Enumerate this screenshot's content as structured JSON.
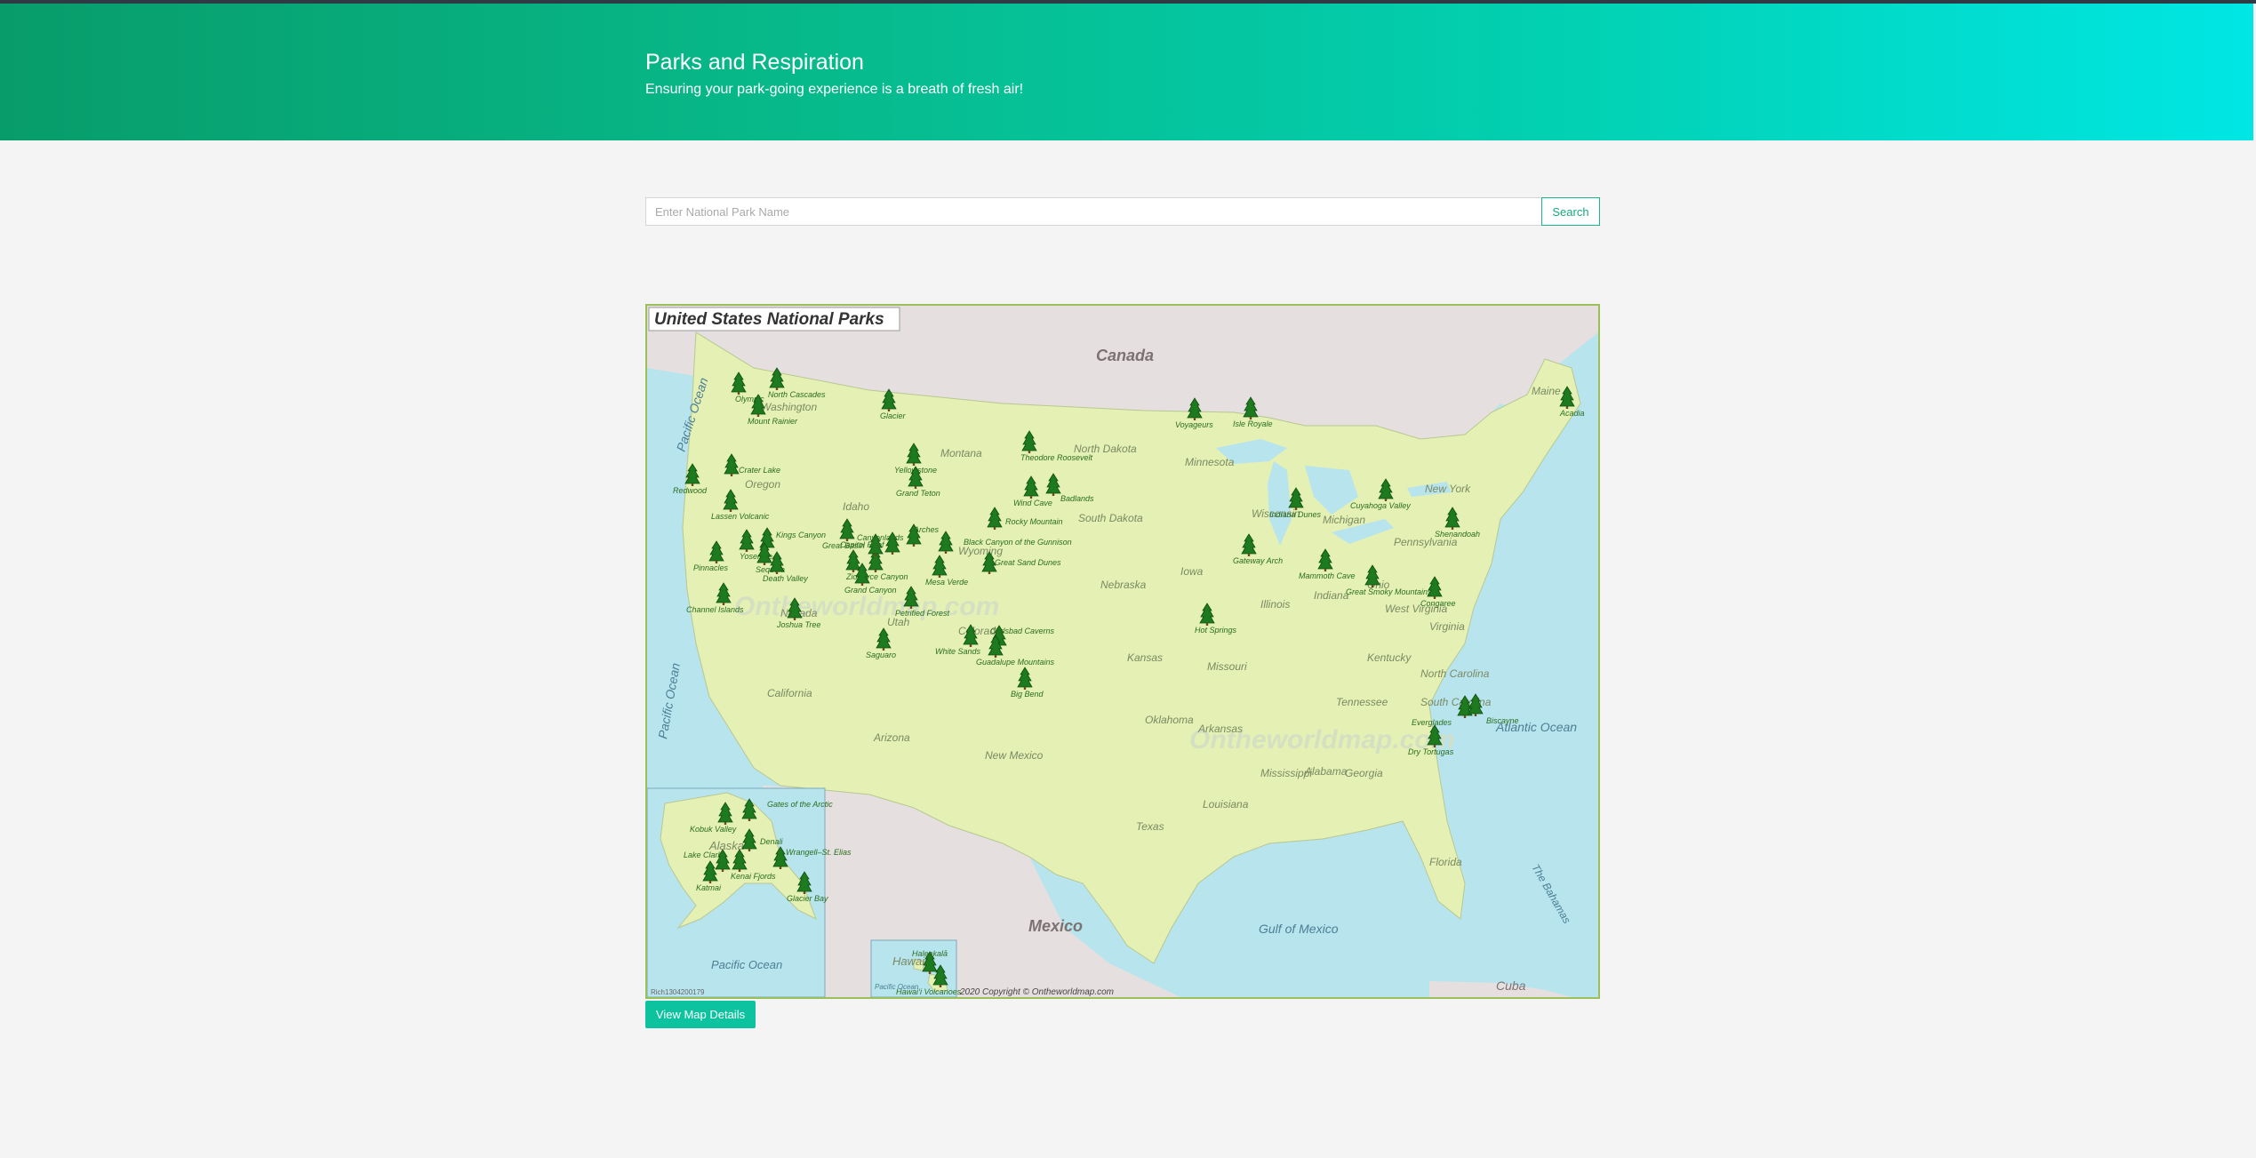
{
  "header": {
    "title": "Parks and Respiration",
    "subtitle": "Ensuring your park-going experience is a breath of fresh air!"
  },
  "search": {
    "placeholder": "Enter National Park Name",
    "value": "",
    "button_label": "Search"
  },
  "map": {
    "title": "United States National Parks",
    "copyright": "2020 Copyright © Ontheworldmap.com",
    "code": "Rich1304200179",
    "watermark": "Ontheworldmap.com",
    "countries": [
      "Canada",
      "Mexico",
      "Cuba",
      "The Bahamas"
    ],
    "waters": [
      "Pacific Ocean",
      "Pacific Ocean",
      "Atlantic Ocean",
      "Gulf of Mexico",
      "Pacific Ocean",
      "Pacific Ocean"
    ],
    "states": [
      "Washington",
      "Oregon",
      "Idaho",
      "Montana",
      "Wyoming",
      "Nevada",
      "Utah",
      "Colorado",
      "California",
      "Arizona",
      "New Mexico",
      "Texas",
      "Oklahoma",
      "Kansas",
      "Nebraska",
      "North Dakota",
      "South Dakota",
      "Minnesota",
      "Iowa",
      "Missouri",
      "Arkansas",
      "Louisiana",
      "Mississippi",
      "Alabama",
      "Georgia",
      "Florida",
      "Tennessee",
      "Kentucky",
      "Illinois",
      "Indiana",
      "Ohio",
      "Wisconsin",
      "Michigan",
      "Pennsylvania",
      "New York",
      "West Virginia",
      "Virginia",
      "North Carolina",
      "South Carolina",
      "Maine",
      "Alaska",
      "Hawaii"
    ],
    "parks": [
      "Olympic",
      "North Cascades",
      "Mount Rainier",
      "Glacier",
      "Crater Lake",
      "Redwood",
      "Lassen Volcanic",
      "Yellowstone",
      "Grand Teton",
      "Theodore Roosevelt",
      "Wind Cave",
      "Badlands",
      "Voyageurs",
      "Isle Royale",
      "Acadia",
      "Great Basin",
      "Yosemite",
      "Kings Canyon",
      "Sequoia",
      "Pinnacles",
      "Death Valley",
      "Channel Islands",
      "Joshua Tree",
      "Zion",
      "Bryce Canyon",
      "Capitol Reef",
      "Canyonlands",
      "Arches",
      "Black Canyon of the Gunnison",
      "Rocky Mountain",
      "Great Sand Dunes",
      "Mesa Verde",
      "Grand Canyon",
      "Petrified Forest",
      "Saguaro",
      "White Sands",
      "Carlsbad Caverns",
      "Guadalupe Mountains",
      "Big Bend",
      "Hot Springs",
      "Gateway Arch",
      "Mammoth Cave",
      "Great Smoky Mountains",
      "Congaree",
      "Shenandoah",
      "Cuyahoga Valley",
      "Indiana Dunes",
      "Everglades",
      "Biscayne",
      "Dry Tortugas",
      "Gates of the Arctic",
      "Kobuk Valley",
      "Denali",
      "Lake Clark",
      "Wrangell–St. Elias",
      "Kenai Fjords",
      "Katmai",
      "Glacier Bay",
      "Haleakalā",
      "Hawaiʻi Volcanoes"
    ],
    "colors": {
      "land": "#e4f0b4",
      "water": "#b8e4ee",
      "neighbor": "#e6dfdf",
      "tree": "#1e7a1e",
      "park_label": "#2a6e1e",
      "border": "#9bc05a"
    }
  },
  "details_button": {
    "label": "View Map Details"
  },
  "colors": {
    "accent": "#0cc29f",
    "hero_start": "#089c6a",
    "hero_end": "#00e6e4"
  }
}
